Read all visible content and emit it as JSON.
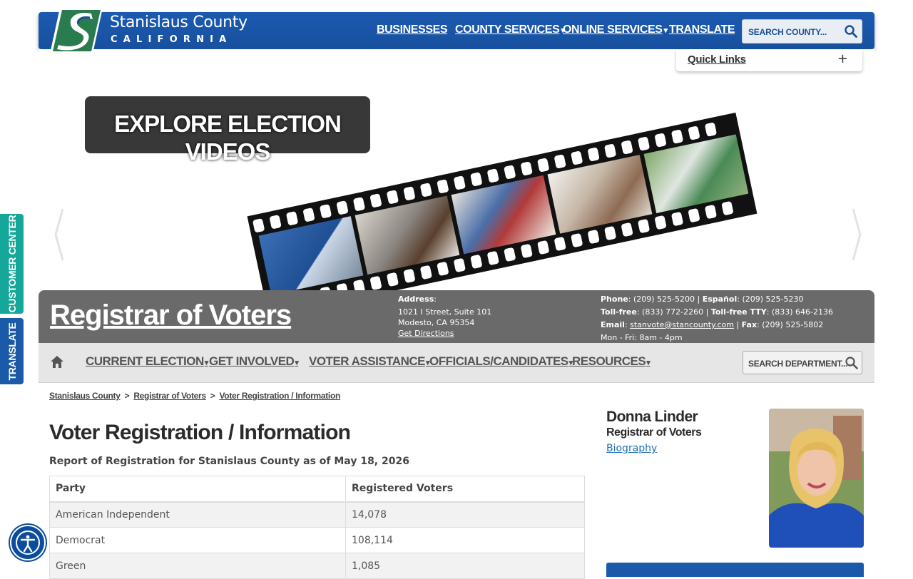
{
  "site": {
    "logo_name": "Stanislaus County",
    "logo_sub": "CALIFORNIA",
    "nav": [
      {
        "label": "BUSINESSES",
        "dropdown": false
      },
      {
        "label": "COUNTY SERVICES",
        "dropdown": true
      },
      {
        "label": "ONLINE SERVICES",
        "dropdown": true
      },
      {
        "label": "TRANSLATE",
        "dropdown": false
      }
    ],
    "search_placeholder": "SEARCH COUNTY...",
    "quick_links_label": "Quick Links",
    "quick_links_icon": "+",
    "brand_color": "#1c5ab0"
  },
  "hero": {
    "caption": "EXPLORE ELECTION VIDEOS"
  },
  "side_tabs": {
    "customer_center": "CUSTOMER CENTER",
    "translate": "TRANSLATE",
    "accessibility_icon": "accessibility-icon"
  },
  "department": {
    "title": "Registrar of Voters",
    "address_label": "Address",
    "address_line1": "1021 I Street, Suite 101",
    "address_line2": "Modesto, CA 95354",
    "directions_label": "Get Directions",
    "phone_label": "Phone",
    "phone": "(209) 525-5200",
    "espanol_label": "Español",
    "espanol": "(209) 525-5230",
    "tollfree_label": "Toll-free",
    "tollfree": "(833) 772-2260",
    "tty_label": "Toll-free TTY",
    "tty": "(833) 646-2136",
    "email_label": "Email",
    "email": "stanvote@stancounty.com",
    "fax_label": "Fax",
    "fax": "(209) 525-5802",
    "hours": "Mon - Fri: 8am - 4pm"
  },
  "dept_nav": {
    "items": [
      {
        "label": "CURRENT ELECTION"
      },
      {
        "label": "GET INVOLVED"
      },
      {
        "label": "VOTER ASSISTANCE"
      },
      {
        "label": "OFFICIALS/CANDIDATES"
      },
      {
        "label": "RESOURCES"
      }
    ],
    "search_placeholder": "SEARCH DEPARTMENT..."
  },
  "breadcrumb": [
    "Stanislaus County",
    "Registrar of Voters",
    "Voter Registration / Information"
  ],
  "main": {
    "title": "Voter Registration / Information",
    "subtitle": "Report of Registration for Stanislaus County as of May 18, 2026",
    "table": {
      "headers": [
        "Party",
        "Registered Voters"
      ],
      "rows": [
        [
          "American Independent",
          "14,078"
        ],
        [
          "Democrat",
          "108,114"
        ],
        [
          "Green",
          "1,085"
        ]
      ]
    }
  },
  "official": {
    "name": "Donna Linder",
    "title": "Registrar of Voters",
    "bio_label": "Biography"
  }
}
